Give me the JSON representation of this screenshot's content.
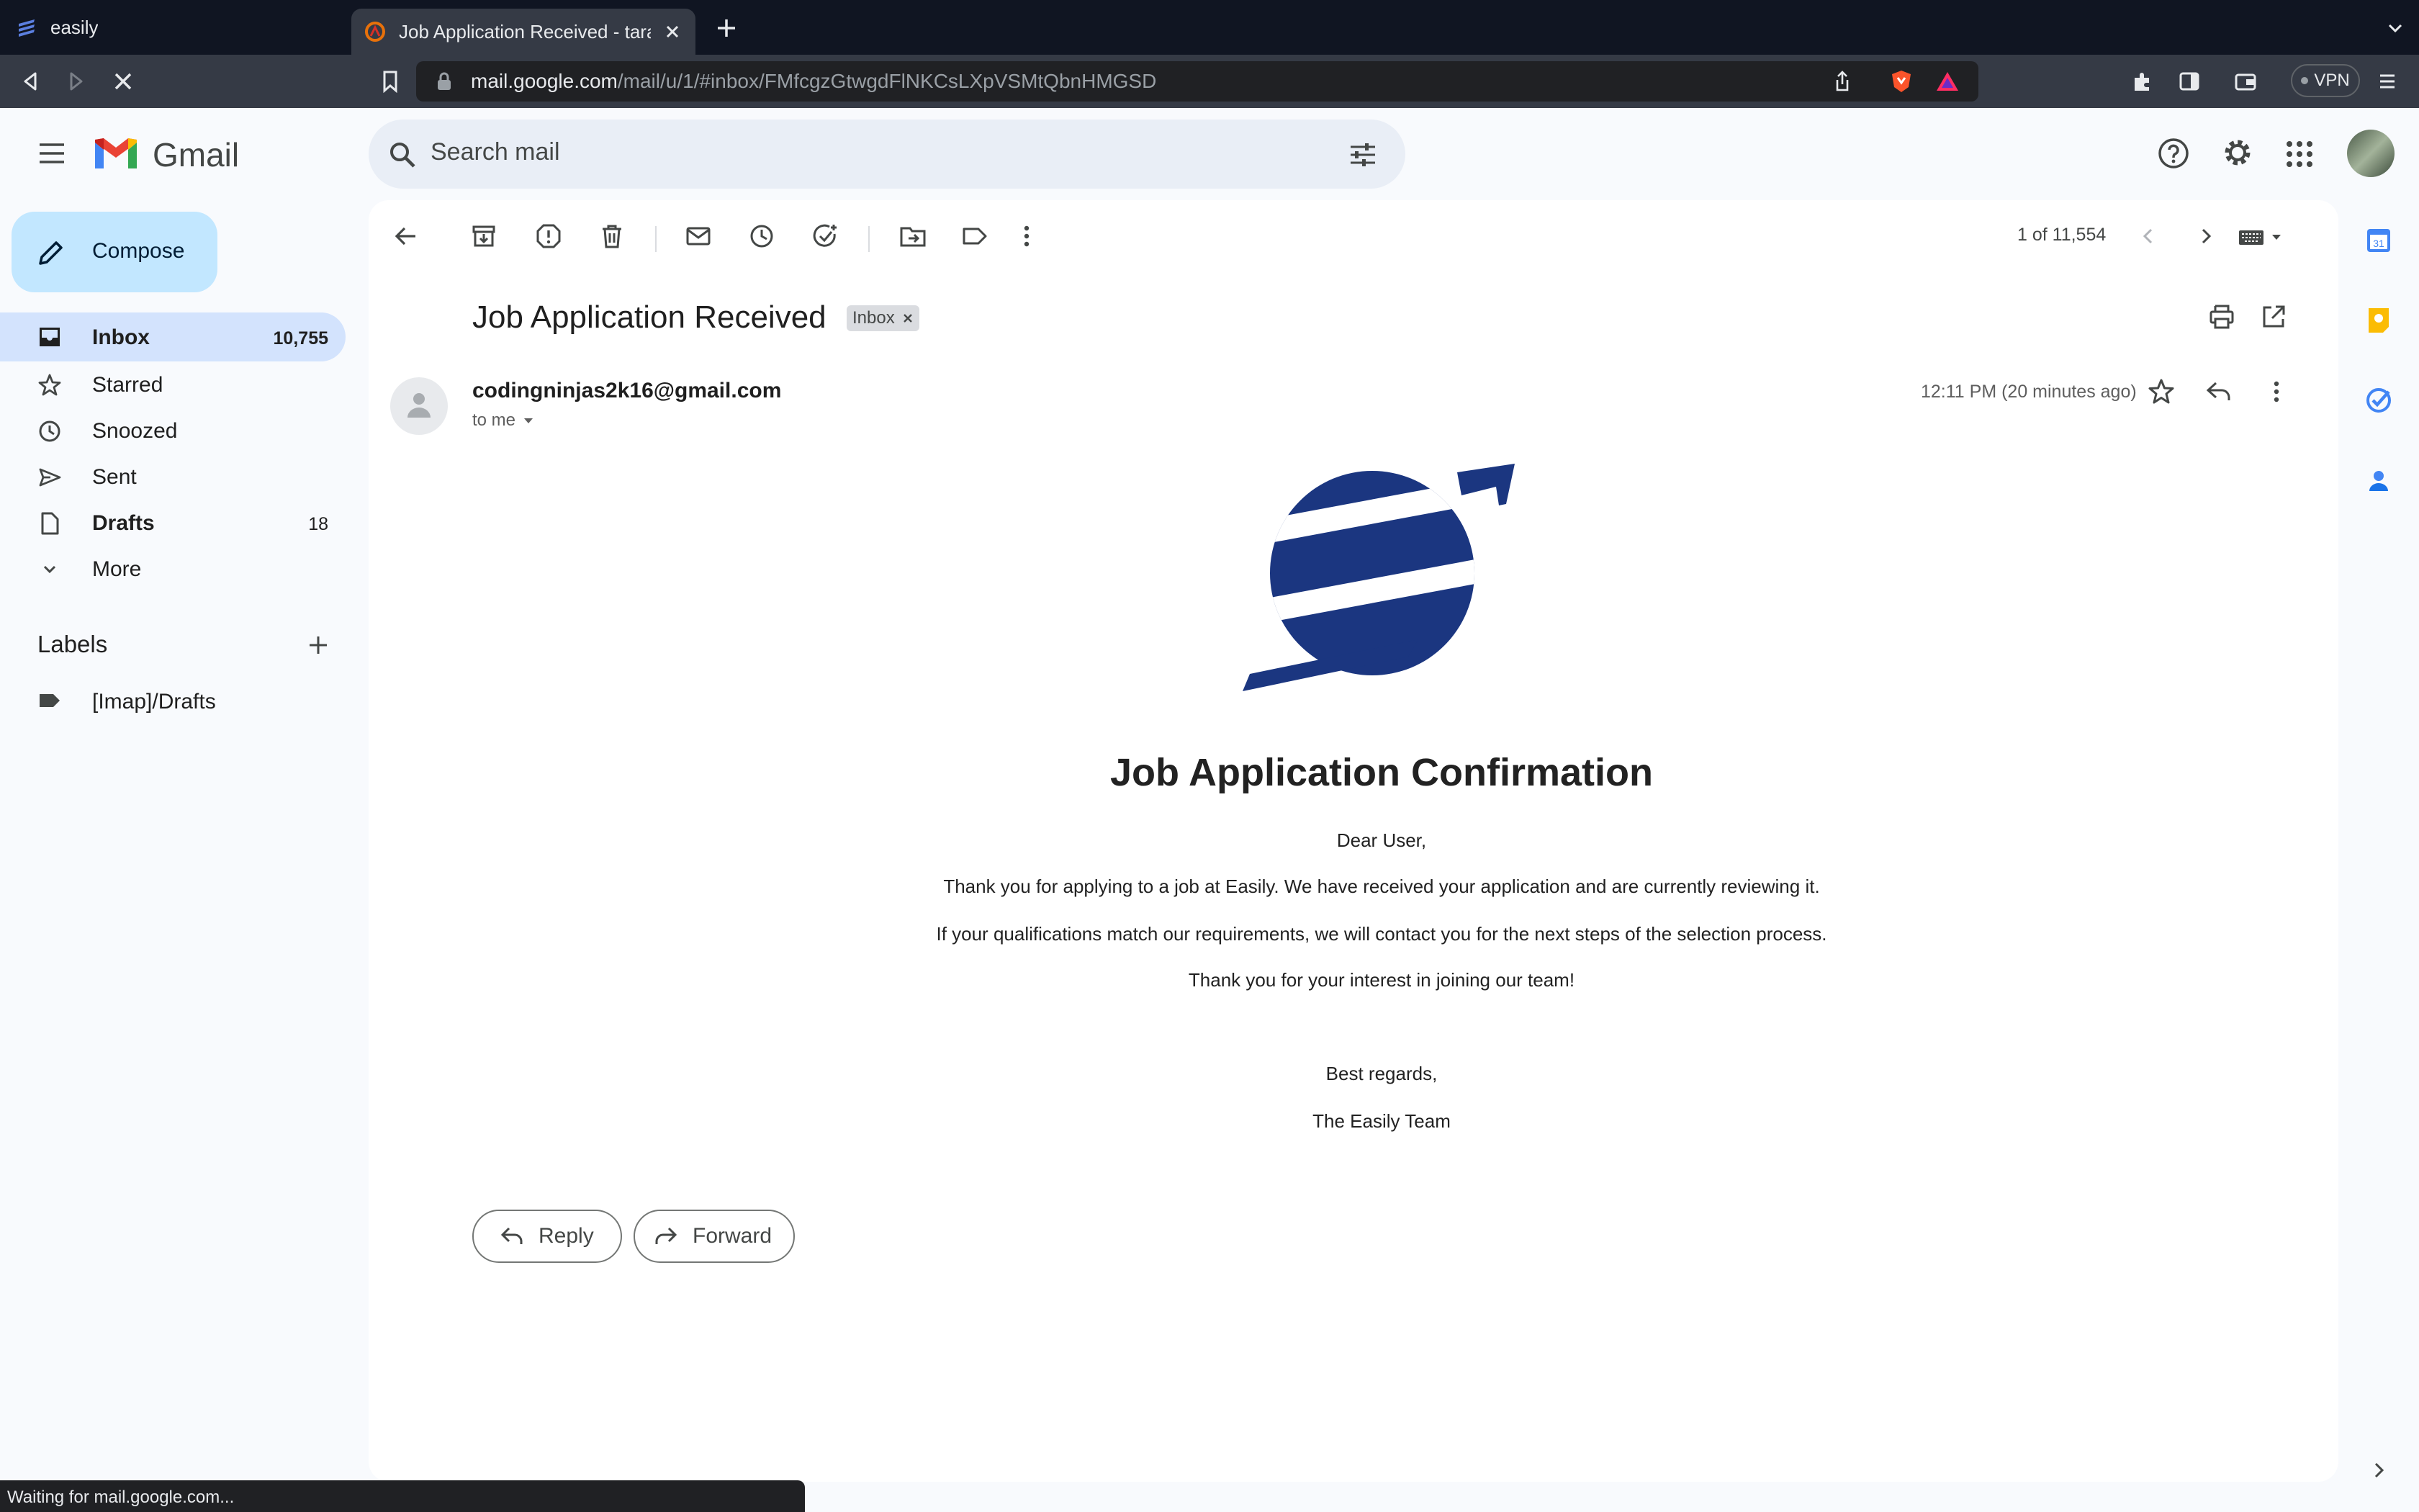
{
  "browser": {
    "tabs": [
      {
        "title": "easily",
        "active": false
      },
      {
        "title": "Job Application Received - tara",
        "active": true
      }
    ],
    "url_host": "mail.google.com",
    "url_path": "/mail/u/1/#inbox/FMfcgzGtwgdFlNKCsLXpVSMtQbnHMGSD",
    "vpn_label": "VPN",
    "status_text": "Waiting for mail.google.com..."
  },
  "gmail": {
    "product_name": "Gmail",
    "search_placeholder": "Search mail",
    "compose_label": "Compose",
    "nav": [
      {
        "label": "Inbox",
        "count": "10,755",
        "icon": "inbox-icon"
      },
      {
        "label": "Starred",
        "count": "",
        "icon": "star-icon"
      },
      {
        "label": "Snoozed",
        "count": "",
        "icon": "clock-icon"
      },
      {
        "label": "Sent",
        "count": "",
        "icon": "send-icon"
      },
      {
        "label": "Drafts",
        "count": "18",
        "icon": "draft-icon"
      },
      {
        "label": "More",
        "count": "",
        "icon": "chevron-down-icon"
      }
    ],
    "labels_heading": "Labels",
    "labels": [
      {
        "label": "[Imap]/Drafts"
      }
    ]
  },
  "message": {
    "pager": "1 of 11,554",
    "subject": "Job Application Received",
    "chip": "Inbox",
    "sender": "codingninjas2k16@gmail.com",
    "to": "to me",
    "time": "12:11 PM (20 minutes ago)",
    "title": "Job Application Confirmation",
    "body": [
      "Dear User,",
      "Thank you for applying to a job at Easily. We have received your application and are currently reviewing it.",
      "If your qualifications match our requirements, we will contact you for the next steps of the selection process.",
      "Thank you for your interest in joining our team!",
      "Best regards,",
      "The Easily Team"
    ],
    "reply_label": "Reply",
    "forward_label": "Forward"
  },
  "colors": {
    "accent_blue": "#0b57d0",
    "logo_navy": "#1b3680",
    "compose_bg": "#c2e7ff",
    "inbox_selected_bg": "#d3e3fd"
  }
}
